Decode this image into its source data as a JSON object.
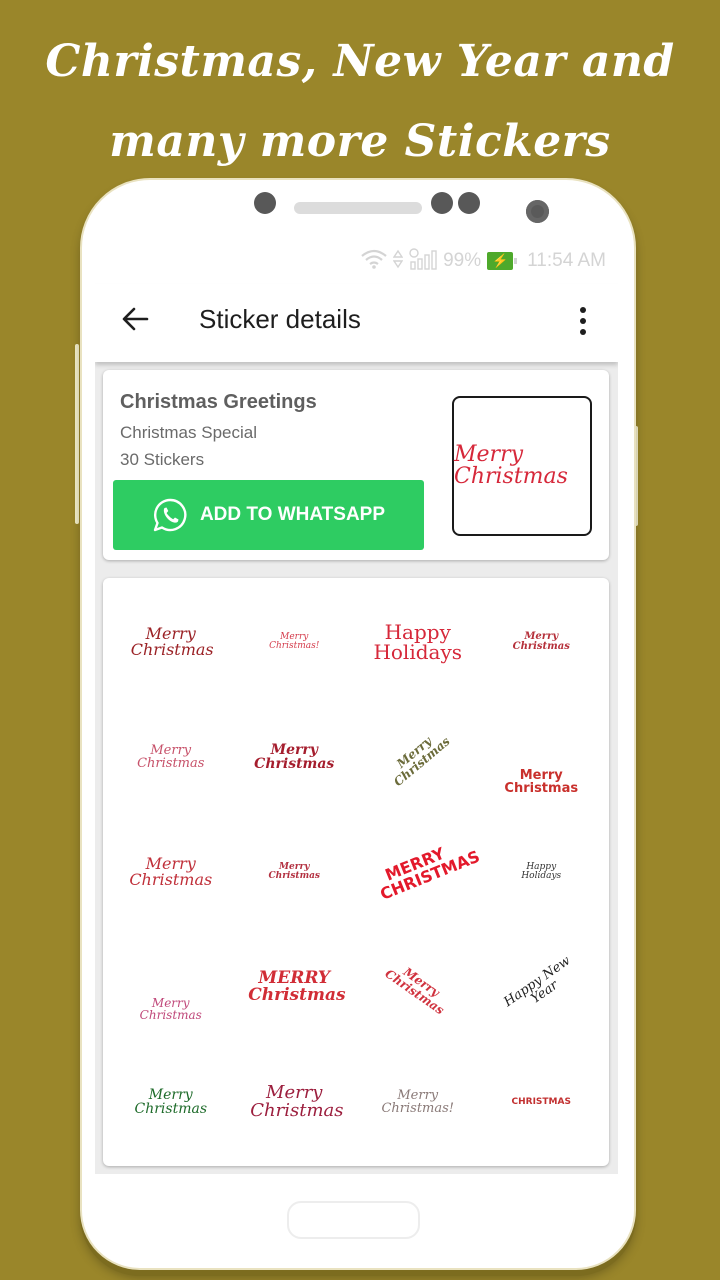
{
  "promo": {
    "line1": "Christmas, New Year and",
    "line2": "many more Stickers"
  },
  "colors": {
    "background": "#9a862a",
    "whatsapp_green": "#2ecc62",
    "battery_green": "#4ea92b"
  },
  "status_bar": {
    "icons": [
      "wifi-icon",
      "data-arrows-icon",
      "signal-icon",
      "battery-charging-icon"
    ],
    "battery": "99%",
    "time": "11:54 AM"
  },
  "app_bar": {
    "back_icon": "arrow-left-icon",
    "title": "Sticker details",
    "menu_icon": "more-vert-icon"
  },
  "pack": {
    "name": "Christmas Greetings",
    "publisher": "Christmas Special",
    "count": "30 Stickers",
    "add_button_label": "ADD TO WHATSAPP",
    "add_button_icon": "whatsapp-icon",
    "tray_icon_text": "Merry Christmas"
  },
  "stickers": [
    {
      "text": "Merry Christmas",
      "color": "#9b2226"
    },
    {
      "text": "Merry Christmas!",
      "color": "#d43b4b"
    },
    {
      "text": "Happy Holidays",
      "color": "#d6283a"
    },
    {
      "text": "Merry Christmas",
      "color": "#b5303a"
    },
    {
      "text": "Merry Christmas",
      "color": "#c7526a"
    },
    {
      "text": "Merry Christmas",
      "color": "#a51d2d"
    },
    {
      "text": "Merry Christmas",
      "color": "#6b6b3a"
    },
    {
      "text": "Merry Christmas",
      "color": "#c9302c"
    },
    {
      "text": "Merry Christmas",
      "color": "#c0303a"
    },
    {
      "text": "Merry Christmas",
      "color": "#b33040"
    },
    {
      "text": "MERRY CHRISTMAS",
      "color": "#e3192b"
    },
    {
      "text": "Happy Holidays",
      "color": "#333333"
    },
    {
      "text": "Merry Christmas",
      "color": "#c0487a"
    },
    {
      "text": "MERRY Christmas",
      "color": "#d12d36"
    },
    {
      "text": "Merry Christmas",
      "color": "#d0333f"
    },
    {
      "text": "Happy New Year",
      "color": "#222222"
    },
    {
      "text": "Merry Christmas",
      "color": "#1e6b2a"
    },
    {
      "text": "Merry Christmas",
      "color": "#9c1f3e"
    },
    {
      "text": "Merry Christmas!",
      "color": "#8a7a78"
    },
    {
      "text": "CHRISTMAS",
      "color": "#c23030"
    }
  ]
}
